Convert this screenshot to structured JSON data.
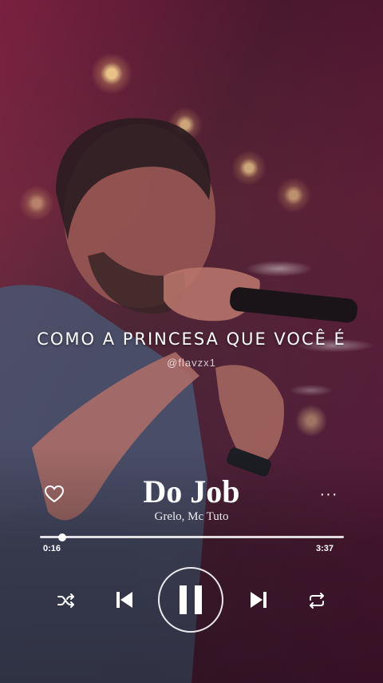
{
  "lyric": "COMO A PRINCESA QUE VOCÊ É",
  "watermark": "@flavzx1",
  "player": {
    "title": "Do Job",
    "artist": "Grelo, Mc Tuto",
    "current_time": "0:16",
    "total_time": "3:37",
    "progress": 0.074,
    "state": "playing"
  },
  "icons": {
    "like": "heart-outline-icon",
    "more": "more-horizontal-icon",
    "shuffle": "shuffle-icon",
    "previous": "skip-previous-icon",
    "pause": "pause-icon",
    "next": "skip-next-icon",
    "repeat": "repeat-icon"
  },
  "more_label": "···"
}
